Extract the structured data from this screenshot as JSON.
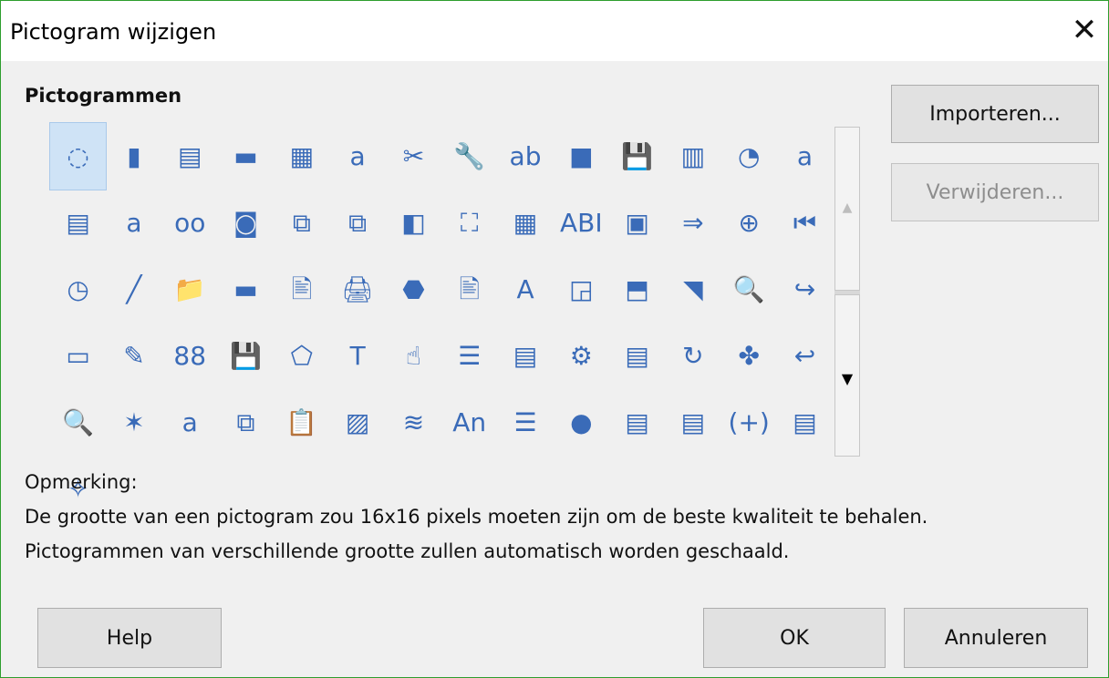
{
  "window": {
    "title": "Pictogram wijzigen"
  },
  "icons_section": {
    "heading": "Pictogrammen"
  },
  "icons": [
    "◌",
    "▮",
    "▤",
    "▬",
    "▦",
    "a",
    "✂",
    "🔧",
    "ab",
    "■",
    "💾",
    "▥",
    "◔",
    "a",
    "▤",
    "a",
    "oo",
    "◙",
    "⧉",
    "⧉",
    "◧",
    "⛶",
    "▦",
    "ABI",
    "▣",
    "⇒",
    "⊕",
    "⏮",
    "◷",
    "╱",
    "📁",
    "▬",
    "🖹",
    "🖨",
    "⬣",
    "🖹",
    "A",
    "◲",
    "⬒",
    "◥",
    "🔍",
    "↪",
    "▭",
    "✎",
    "88",
    "💾",
    "⬠",
    "T",
    "☝",
    "☰",
    "▤",
    "⚙",
    "▤",
    "↻",
    "✤",
    "↩",
    "🔍",
    "✶",
    "a",
    "⧉",
    "📋",
    "▨",
    "≋",
    "An",
    "☰",
    "●",
    "▤",
    "▤",
    "(+)",
    "▤",
    "✧"
  ],
  "buttons": {
    "import": "Importeren...",
    "delete": "Verwijderen...",
    "help": "Help",
    "ok": "OK",
    "cancel": "Annuleren"
  },
  "note": {
    "label": "Opmerking:",
    "line1": "De grootte van een pictogram zou 16x16 pixels moeten zijn om de beste kwaliteit te behalen.",
    "line2": "Pictogrammen van verschillende grootte zullen automatisch worden geschaald."
  },
  "colors": {
    "window_border": "#2e9e2e",
    "selected_bg": "#cfe3f6",
    "dialog_bg": "#f0f0f0"
  }
}
